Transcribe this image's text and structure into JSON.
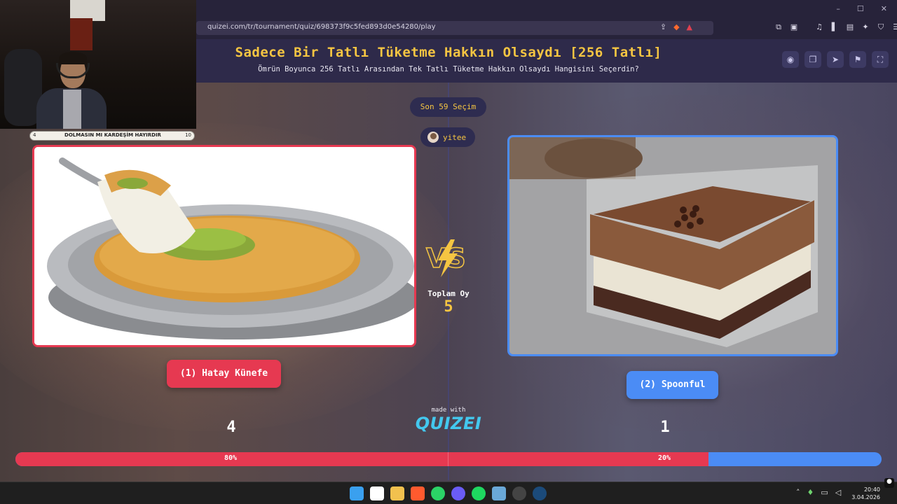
{
  "browser": {
    "url": "quizei.com/tr/tournament/quiz/698373f9c5fed893d0e54280/play",
    "window_controls": [
      "–",
      "☐",
      "✕"
    ]
  },
  "quiz": {
    "title": "Sadece Bir Tatlı Tüketme Hakkın Olsaydı [256 Tatlı]",
    "subtitle": "Ömrün Boyunca 256 Tatlı Arasından Tek Tatlı Tüketme Hakkın Olsaydı Hangisini Seçerdin?"
  },
  "round": {
    "selection_count": "Son 59 Seçim",
    "user": "yitee",
    "total_label": "Toplam Oy",
    "total_value": "5"
  },
  "left": {
    "label": "(1) Hatay Künefe",
    "votes": "4",
    "percent_label": "80%",
    "percent": 0.8,
    "color": "#e63951"
  },
  "right": {
    "label": "(2) Spoonful",
    "votes": "1",
    "percent_label": "20%",
    "percent": 0.2,
    "color": "#4b8cf5"
  },
  "footer": {
    "made_with": "made with",
    "brand": "QUIZEI"
  },
  "webcam": {
    "counter_min": "4",
    "counter_text": "DOLMASIN MI KARDEŞİM HAYIRDIR",
    "counter_max": "10"
  },
  "taskbar": {
    "time": "20:40",
    "date": "3.04.2026"
  },
  "colors": {
    "accent_gold": "#f5c542",
    "header_bg": "#2e2a4a",
    "brand_cyan": "#43c8ee"
  }
}
